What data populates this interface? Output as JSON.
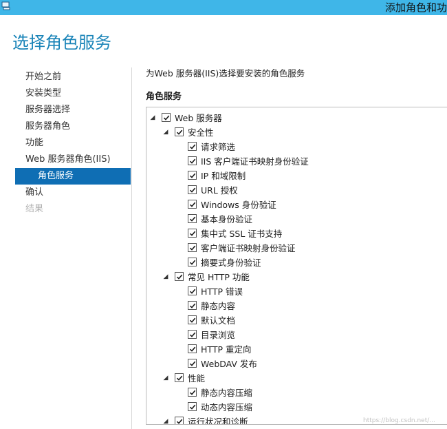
{
  "window": {
    "title": "添加角色和功"
  },
  "page": {
    "title": "选择角色服务"
  },
  "nav": {
    "items": [
      {
        "label": "开始之前",
        "state": "normal"
      },
      {
        "label": "安装类型",
        "state": "normal"
      },
      {
        "label": "服务器选择",
        "state": "normal"
      },
      {
        "label": "服务器角色",
        "state": "normal"
      },
      {
        "label": "功能",
        "state": "normal"
      },
      {
        "label": "Web 服务器角色(IIS)",
        "state": "normal"
      },
      {
        "label": "角色服务",
        "state": "active"
      },
      {
        "label": "确认",
        "state": "normal"
      },
      {
        "label": "结果",
        "state": "disabled"
      }
    ]
  },
  "main": {
    "description": "为Web 服务器(IIS)选择要安装的角色服务",
    "section_label": "角色服务",
    "tree": [
      {
        "label": "Web 服务器",
        "level": 0,
        "expander": "expanded",
        "checked": true
      },
      {
        "label": "安全性",
        "level": 1,
        "expander": "expanded",
        "checked": true
      },
      {
        "label": "请求筛选",
        "level": 2,
        "expander": "none",
        "checked": true
      },
      {
        "label": "IIS 客户端证书映射身份验证",
        "level": 2,
        "expander": "none",
        "checked": true
      },
      {
        "label": "IP 和域限制",
        "level": 2,
        "expander": "none",
        "checked": true
      },
      {
        "label": "URL 授权",
        "level": 2,
        "expander": "none",
        "checked": true
      },
      {
        "label": "Windows 身份验证",
        "level": 2,
        "expander": "none",
        "checked": true
      },
      {
        "label": "基本身份验证",
        "level": 2,
        "expander": "none",
        "checked": true
      },
      {
        "label": "集中式 SSL 证书支持",
        "level": 2,
        "expander": "none",
        "checked": true
      },
      {
        "label": "客户端证书映射身份验证",
        "level": 2,
        "expander": "none",
        "checked": true
      },
      {
        "label": "摘要式身份验证",
        "level": 2,
        "expander": "none",
        "checked": true
      },
      {
        "label": "常见 HTTP 功能",
        "level": 1,
        "expander": "expanded",
        "checked": true
      },
      {
        "label": "HTTP 错误",
        "level": 2,
        "expander": "none",
        "checked": true
      },
      {
        "label": "静态内容",
        "level": 2,
        "expander": "none",
        "checked": true
      },
      {
        "label": "默认文档",
        "level": 2,
        "expander": "none",
        "checked": true
      },
      {
        "label": "目录浏览",
        "level": 2,
        "expander": "none",
        "checked": true
      },
      {
        "label": "HTTP 重定向",
        "level": 2,
        "expander": "none",
        "checked": true
      },
      {
        "label": "WebDAV 发布",
        "level": 2,
        "expander": "none",
        "checked": true
      },
      {
        "label": "性能",
        "level": 1,
        "expander": "expanded",
        "checked": true
      },
      {
        "label": "静态内容压缩",
        "level": 2,
        "expander": "none",
        "checked": true
      },
      {
        "label": "动态内容压缩",
        "level": 2,
        "expander": "none",
        "checked": true
      },
      {
        "label": "运行状况和诊断",
        "level": 1,
        "expander": "expanded",
        "checked": true
      }
    ]
  },
  "watermark": {
    "text": "https://blog.csdn.net/..."
  }
}
